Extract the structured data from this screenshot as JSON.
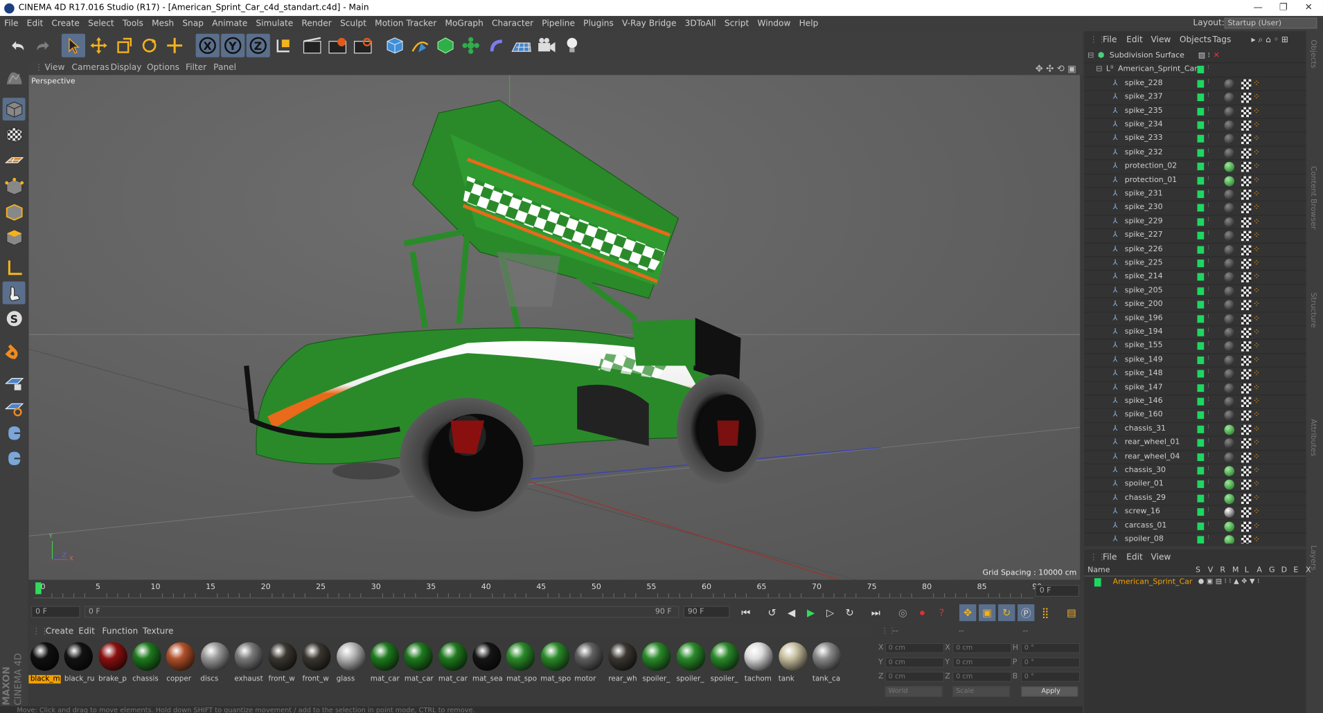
{
  "window": {
    "title": "CINEMA 4D R17.016 Studio (R17) - [American_Sprint_Car_c4d_standart.c4d] - Main",
    "minimize": "—",
    "maximize": "❐",
    "close": "✕"
  },
  "menu": [
    "File",
    "Edit",
    "Create",
    "Select",
    "Tools",
    "Mesh",
    "Snap",
    "Animate",
    "Simulate",
    "Render",
    "Sculpt",
    "Motion Tracker",
    "MoGraph",
    "Character",
    "Pipeline",
    "Plugins",
    "V-Ray Bridge",
    "3DToAll",
    "Script",
    "Window",
    "Help"
  ],
  "layout": {
    "label": "Layout:",
    "value": "Startup (User)"
  },
  "viewport_menu": [
    "View",
    "Cameras",
    "Display",
    "Options",
    "Filter",
    "Panel"
  ],
  "viewport": {
    "name": "Perspective",
    "grid_spacing": "Grid Spacing : 10000 cm",
    "axis_y": "Y",
    "axis_z": "Z",
    "axis_x": "X"
  },
  "timeline": {
    "ticks": [
      "0",
      "5",
      "10",
      "15",
      "20",
      "25",
      "30",
      "35",
      "40",
      "45",
      "50",
      "55",
      "60",
      "65",
      "70",
      "75",
      "80",
      "85",
      "90"
    ],
    "frame_field": "0 F"
  },
  "playback": {
    "start": "0 F",
    "slider_start": "0 F",
    "slider_end": "90 F",
    "end": "90 F"
  },
  "material_menu": [
    "Create",
    "Edit",
    "Function",
    "Texture"
  ],
  "materials": [
    {
      "name": "black_m",
      "color": "#101010",
      "active": true
    },
    {
      "name": "black_ru",
      "color": "#121212",
      "active": false
    },
    {
      "name": "brake_p",
      "color": "#8a1010",
      "active": false
    },
    {
      "name": "chassis",
      "color": "#1e7a1e",
      "active": false
    },
    {
      "name": "copper",
      "color": "#b0502a",
      "active": false
    },
    {
      "name": "discs",
      "color": "#9a9a9a",
      "active": false
    },
    {
      "name": "exhaust",
      "color": "#7a7a7a",
      "active": false
    },
    {
      "name": "front_w",
      "color": "#3a3630",
      "active": false
    },
    {
      "name": "front_w",
      "color": "#3a3630",
      "active": false
    },
    {
      "name": "glass",
      "color": "#b8b8b8",
      "active": false
    },
    {
      "name": "mat_car",
      "color": "#1e7a1e",
      "active": false
    },
    {
      "name": "mat_car",
      "color": "#1e7a1e",
      "active": false
    },
    {
      "name": "mat_car",
      "color": "#1e7a1e",
      "active": false
    },
    {
      "name": "mat_sea",
      "color": "#151515",
      "active": false
    },
    {
      "name": "mat_spo",
      "color": "#2a8a2a",
      "active": false
    },
    {
      "name": "mat_spo",
      "color": "#2a8a2a",
      "active": false
    },
    {
      "name": "motor",
      "color": "#606060",
      "active": false
    },
    {
      "name": "rear_wh",
      "color": "#3a3630",
      "active": false
    },
    {
      "name": "spoiler_",
      "color": "#2a8a2a",
      "active": false
    },
    {
      "name": "spoiler_",
      "color": "#2a8a2a",
      "active": false
    },
    {
      "name": "spoiler_",
      "color": "#2a8a2a",
      "active": false
    },
    {
      "name": "tachom",
      "color": "#dddddd",
      "active": false
    },
    {
      "name": "tank",
      "color": "#c8c0a0",
      "active": false
    },
    {
      "name": "tank_ca",
      "color": "#8a8a8a",
      "active": false
    }
  ],
  "coords": {
    "hdr1": "--",
    "hdr2": "--",
    "hdr3": "--",
    "x": "X",
    "y": "Y",
    "z": "Z",
    "h": "H",
    "p": "P",
    "b": "B",
    "x_val": "0 cm",
    "y_val": "0 cm",
    "z_val": "0 cm",
    "sx_val": "0 cm",
    "sy_val": "0 cm",
    "sz_val": "0 cm",
    "h_val": "0 °",
    "p_val": "0 °",
    "b_val": "0 °",
    "world": "World",
    "scale": "Scale",
    "apply": "Apply"
  },
  "status": "Move: Click and drag to move elements. Hold down SHIFT to quantize movement / add to the selection in point mode, CTRL to remove.",
  "object_manager": {
    "menu": [
      "File",
      "Edit",
      "View",
      "Objects",
      "Tags"
    ],
    "root": "Subdivision Surface",
    "group": "American_Sprint_Car",
    "items": [
      "spike_228",
      "spike_237",
      "spike_235",
      "spike_234",
      "spike_233",
      "spike_232",
      "protection_02",
      "protection_01",
      "spike_231",
      "spike_230",
      "spike_229",
      "spike_227",
      "spike_226",
      "spike_225",
      "spike_214",
      "spike_205",
      "spike_200",
      "spike_196",
      "spike_194",
      "spike_155",
      "spike_149",
      "spike_148",
      "spike_147",
      "spike_146",
      "spike_160",
      "chassis_31",
      "rear_wheel_01",
      "rear_wheel_04",
      "chassis_30",
      "spoiler_01",
      "chassis_29",
      "screw_16",
      "carcass_01",
      "spoiler_08"
    ]
  },
  "attribute_manager": {
    "menu": [
      "File",
      "Edit",
      "View"
    ],
    "columns": [
      "Name",
      "S",
      "V",
      "R",
      "M",
      "L",
      "A",
      "G",
      "D",
      "E",
      "X"
    ],
    "row": "American_Sprint_Car"
  },
  "side_tabs": [
    "Objects",
    "Content Browser",
    "Structure",
    "Attributes",
    "Layers"
  ],
  "logo": {
    "line1": "MAXON",
    "line2": "CINEMA 4D"
  }
}
